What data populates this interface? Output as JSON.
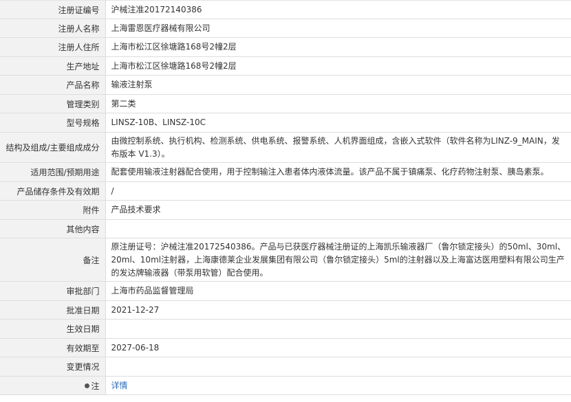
{
  "rows": [
    {
      "label": "注册证编号",
      "value": "沪械注准20172140386"
    },
    {
      "label": "注册人名称",
      "value": "上海雷恩医疗器械有限公司"
    },
    {
      "label": "注册人住所",
      "value": "上海市松江区徐塘路168号2幢2层"
    },
    {
      "label": "生产地址",
      "value": "上海市松江区徐塘路168号2幢2层"
    },
    {
      "label": "产品名称",
      "value": "输液注射泵"
    },
    {
      "label": "管理类别",
      "value": "第二类"
    },
    {
      "label": "型号规格",
      "value": "LINSZ-10B、LINSZ-10C"
    },
    {
      "label": "结构及组成/主要组成成分",
      "value": "由微控制系统、执行机构、检测系统、供电系统、报警系统、人机界面组成，含嵌入式软件（软件名称为LINZ-9_MAIN，发布版本 V1.3）。"
    },
    {
      "label": "适用范围/预期用途",
      "value": "配套使用输液注射器配合使用，用于控制输注入患者体内液体流量。该产品不属于镇痛泵、化疗药物注射泵、胰岛素泵。"
    },
    {
      "label": "产品储存条件及有效期",
      "value": "/"
    },
    {
      "label": "附件",
      "value": "产品技术要求"
    },
    {
      "label": "其他内容",
      "value": ""
    },
    {
      "label": "备注",
      "value": "原注册证号：沪械注准20172540386。产品与已获医疗器械注册证的上海凯乐输液器厂（鲁尔锁定接头）的50ml、30ml、20ml、10ml注射器，上海康德莱企业发展集团有限公司（鲁尔锁定接头）5ml的注射器以及上海富达医用塑料有限公司生产的发达牌输液器（带泵用软管）配合使用。"
    },
    {
      "label": "审批部门",
      "value": "上海市药品监督管理局"
    },
    {
      "label": "批准日期",
      "value": "2021-12-27"
    },
    {
      "label": "生效日期",
      "value": ""
    },
    {
      "label": "有效期至",
      "value": "2027-06-18"
    },
    {
      "label": "变更情况",
      "value": ""
    }
  ],
  "note": {
    "label": "注",
    "icon": "pin-icon",
    "link_text": "详情"
  }
}
